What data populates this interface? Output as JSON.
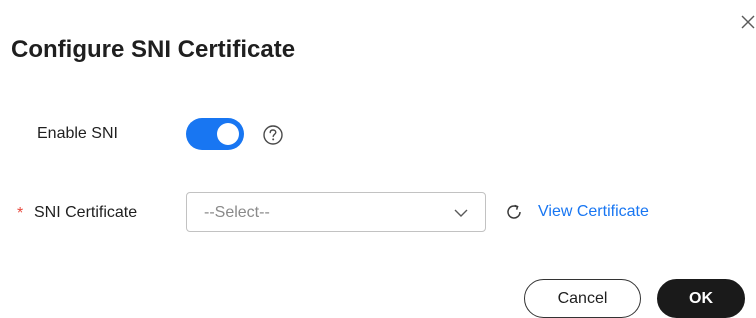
{
  "dialog": {
    "title": "Configure SNI Certificate",
    "close_icon": "close-icon"
  },
  "form": {
    "enable_sni": {
      "label": "Enable SNI",
      "enabled": true,
      "help_icon": "question-circle-icon"
    },
    "sni_certificate": {
      "required_mark": "*",
      "label": "SNI Certificate",
      "select_value": "--Select--",
      "dropdown_icon": "chevron-down-icon",
      "refresh_icon": "refresh-icon",
      "view_link": "View Certificate"
    }
  },
  "footer": {
    "cancel_label": "Cancel",
    "ok_label": "OK"
  },
  "colors": {
    "accent": "#1876f2",
    "required": "#e8473b",
    "ok_button": "#1a1a1a"
  }
}
